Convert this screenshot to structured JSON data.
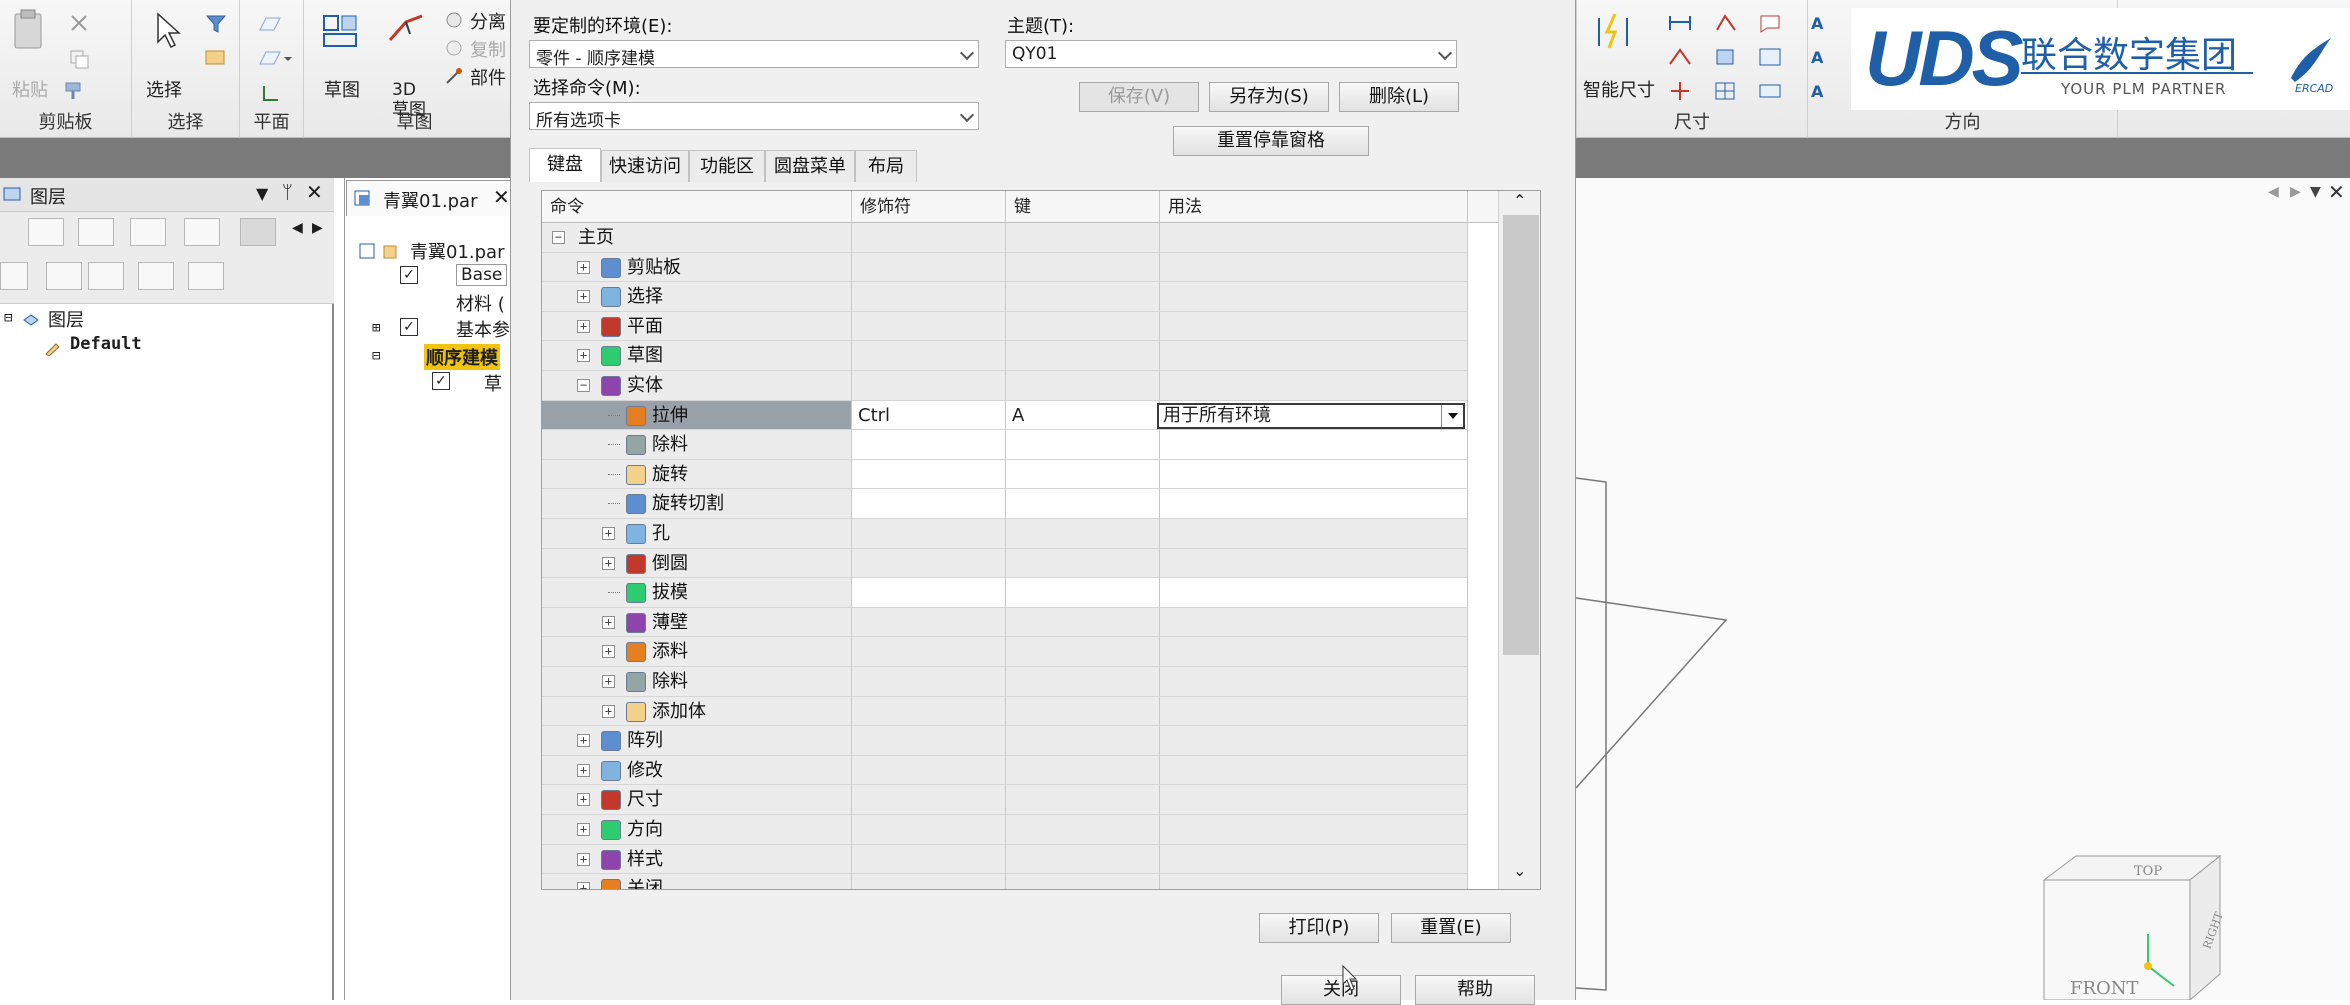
{
  "ribbon": {
    "clipboard": {
      "paste": "粘贴",
      "group": "剪贴板"
    },
    "select": {
      "select": "选择",
      "group": "选择"
    },
    "plane": {
      "group": "平面"
    },
    "sketch": {
      "sketch": "草图",
      "sketch3d": "3D\n草图",
      "group": "草图",
      "split": "分离",
      "copy": "复制",
      "part": "部件"
    },
    "dims": {
      "smart_dim": "智能尺寸",
      "group": "尺寸"
    },
    "orient": {
      "group": "方向"
    }
  },
  "logo": {
    "brand": "UDS",
    "company": "联合数字集团",
    "slogan": "YOUR PLM PARTNER",
    "mark": "ERCAD"
  },
  "left_panel": {
    "title": "图层",
    "tree_root": "图层",
    "tree_child": "Default"
  },
  "doc": {
    "tab": "青翼01.par",
    "tree": [
      "青翼01.par",
      "Base",
      "材料 (",
      "基本参",
      "顺序建模",
      "草"
    ]
  },
  "dialog": {
    "env_label": "要定制的环境(E):",
    "env_value": "零件 - 顺序建模",
    "theme_label": "主题(T):",
    "theme_value": "QY01",
    "cmd_label": "选择命令(M):",
    "cmd_value": "所有选项卡",
    "save": "保存(V)",
    "save_as": "另存为(S)",
    "delete": "删除(L)",
    "reset_docking": "重置停靠窗格",
    "tabs": [
      "键盘",
      "快速访问",
      "功能区",
      "圆盘菜单",
      "布局"
    ],
    "columns": [
      "命令",
      "修饰符",
      "键",
      "用法"
    ],
    "rows": [
      {
        "label": "主页",
        "level": 0,
        "expander": "−",
        "icon": ""
      },
      {
        "label": "剪贴板",
        "level": 1,
        "expander": "+",
        "icon": "clipboard-icon"
      },
      {
        "label": "选择",
        "level": 1,
        "expander": "+",
        "icon": "cursor-icon"
      },
      {
        "label": "平面",
        "level": 1,
        "expander": "+",
        "icon": "plane-icon"
      },
      {
        "label": "草图",
        "level": 1,
        "expander": "+",
        "icon": "sketch-icon"
      },
      {
        "label": "实体",
        "level": 1,
        "expander": "−",
        "icon": "solid-icon"
      },
      {
        "label": "拉伸",
        "level": 2,
        "expander": "",
        "icon": "extrude-icon",
        "modifier": "Ctrl",
        "key": "A",
        "usage": "用于所有环境",
        "selected": true
      },
      {
        "label": "除料",
        "level": 2,
        "expander": "",
        "icon": "cutout-icon",
        "white": true
      },
      {
        "label": "旋转",
        "level": 2,
        "expander": "",
        "icon": "revolve-icon",
        "white": true
      },
      {
        "label": "旋转切割",
        "level": 2,
        "expander": "",
        "icon": "revolve-cut-icon",
        "white": true
      },
      {
        "label": "孔",
        "level": 2,
        "expander": "+",
        "icon": "hole-icon"
      },
      {
        "label": "倒圆",
        "level": 2,
        "expander": "+",
        "icon": "round-icon"
      },
      {
        "label": "拔模",
        "level": 2,
        "expander": "",
        "icon": "draft-icon",
        "white": true
      },
      {
        "label": "薄壁",
        "level": 2,
        "expander": "+",
        "icon": "thinwall-icon"
      },
      {
        "label": "添料",
        "level": 2,
        "expander": "+",
        "icon": "add-material-icon"
      },
      {
        "label": "除料",
        "level": 2,
        "expander": "+",
        "icon": "cutout-icon"
      },
      {
        "label": "添加体",
        "level": 2,
        "expander": "+",
        "icon": "add-body-icon"
      },
      {
        "label": "阵列",
        "level": 1,
        "expander": "+",
        "icon": "pattern-icon"
      },
      {
        "label": "修改",
        "level": 1,
        "expander": "+",
        "icon": "modify-icon"
      },
      {
        "label": "尺寸",
        "level": 1,
        "expander": "+",
        "icon": "dimension-icon"
      },
      {
        "label": "方向",
        "level": 1,
        "expander": "+",
        "icon": "orient-icon"
      },
      {
        "label": "样式",
        "level": 1,
        "expander": "+",
        "icon": "style-icon"
      },
      {
        "label": "关闭",
        "level": 1,
        "expander": "+",
        "icon": "close-doc-icon"
      }
    ],
    "print": "打印(P)",
    "reset": "重置(E)",
    "close": "关闭",
    "help": "帮助"
  },
  "viewcube": {
    "top": "TOP",
    "front": "FRONT",
    "right": "RIGHT"
  },
  "colors": {
    "accent_blue": "#1f5fa8",
    "selected_row": "#9aa0a8",
    "dialog_bg": "#f0f0f0"
  }
}
